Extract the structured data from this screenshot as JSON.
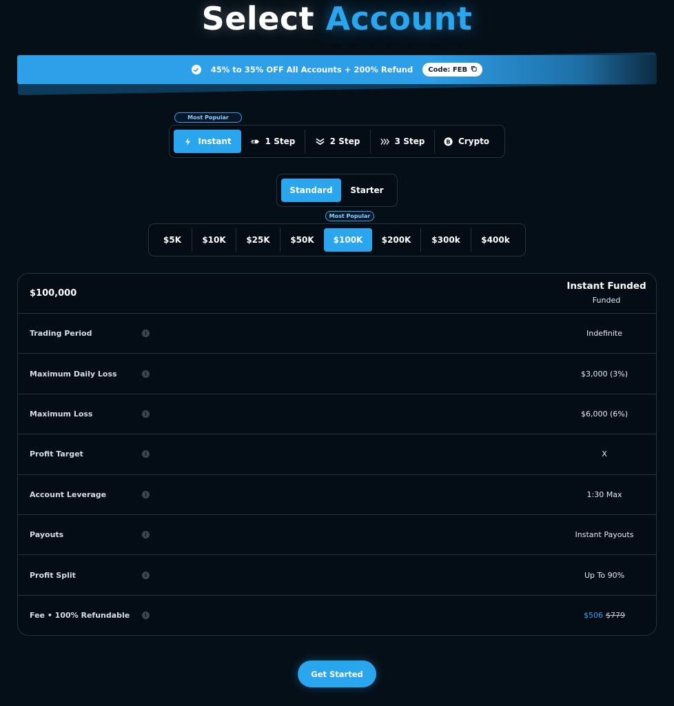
{
  "title": {
    "part1": "Select",
    "part2": "Account"
  },
  "colors": {
    "accent": "#2aa6ee",
    "background": "#050f18",
    "border": "#26323d"
  },
  "promo": {
    "icon": "badge-check-icon",
    "text": "45% to 35% OFF All Accounts + 200% Refund",
    "code_label": "Code: FEB",
    "copy_icon": "copy-icon"
  },
  "account_types": {
    "badge": "Most Popular",
    "selected": "Instant",
    "items": [
      {
        "label": "Instant",
        "icon": "bolt-icon"
      },
      {
        "label": "1 Step",
        "icon": "dash-arrow-icon"
      },
      {
        "label": "2 Step",
        "icon": "double-chevron-down-icon"
      },
      {
        "label": "3 Step",
        "icon": "triple-chevron-right-icon"
      },
      {
        "label": "Crypto",
        "icon": "bitcoin-icon"
      }
    ]
  },
  "plan_variant": {
    "selected": "Standard",
    "items": [
      "Standard",
      "Starter"
    ]
  },
  "sizes": {
    "badge": "Most Popular",
    "selected": "$100K",
    "items": [
      "$5K",
      "$10K",
      "$25K",
      "$50K",
      "$100K",
      "$200K",
      "$300k",
      "$400k"
    ]
  },
  "table": {
    "header": {
      "amount": "$100,000",
      "plan_name": "Instant Funded",
      "plan_sub": "Funded"
    },
    "info_icon": "i",
    "rows": [
      {
        "label": "Trading Period",
        "value": "Indefinite"
      },
      {
        "label": "Maximum Daily Loss",
        "value": "$3,000 (3%)"
      },
      {
        "label": "Maximum Loss",
        "value": "$6,000 (6%)"
      },
      {
        "label": "Profit Target",
        "value": "X"
      },
      {
        "label": "Account Leverage",
        "value": "1:30 Max"
      },
      {
        "label": "Payouts",
        "value": "Instant Payouts"
      },
      {
        "label": "Profit Split",
        "value": "Up To 90%"
      },
      {
        "label": "Fee • 100% Refundable",
        "price_new": "$506",
        "price_old": "$779"
      }
    ]
  },
  "cta": {
    "label": "Get Started"
  }
}
